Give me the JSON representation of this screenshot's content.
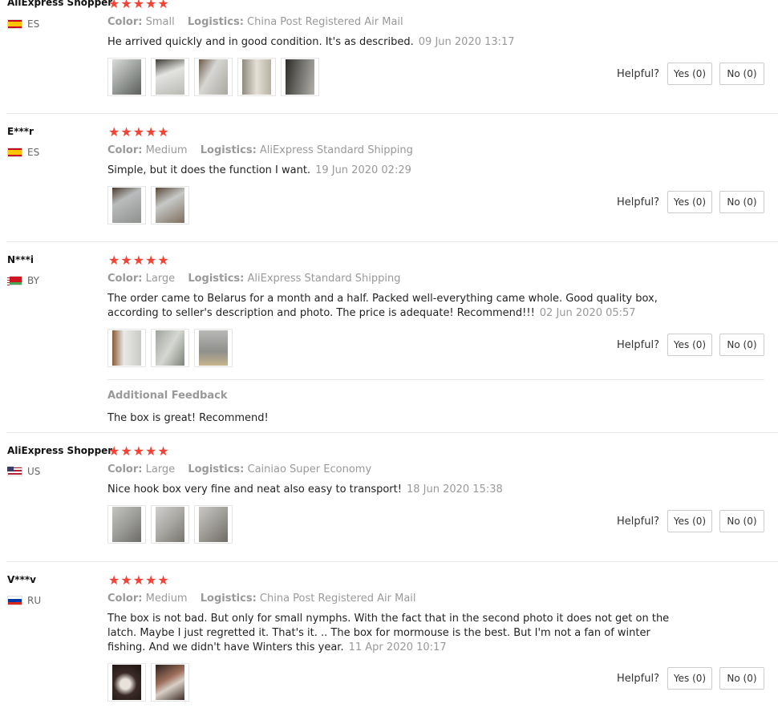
{
  "labels": {
    "color": "Color:",
    "logistics": "Logistics:",
    "helpful": "Helpful?",
    "yes": "Yes (0)",
    "no": "No (0)"
  },
  "reviews": [
    {
      "user": "AliExpress Shopper",
      "country": "ES",
      "color": "Small",
      "logistics": "China Post Registered Air Mail",
      "text": "He arrived quickly and in good condition. It's as described.",
      "date": "09 Jun 2020 13:17",
      "rating": 5,
      "photos": 5
    },
    {
      "user": "E***r",
      "country": "ES",
      "color": "Medium",
      "logistics": "AliExpress Standard Shipping",
      "text": "Simple, but it does the function I want.",
      "date": "19 Jun 2020 02:29",
      "rating": 5,
      "photos": 2
    },
    {
      "user": "N***i",
      "country": "BY",
      "color": "Large",
      "logistics": "AliExpress Standard Shipping",
      "text": "The order came to Belarus for a month and a half. Packed well-everything came whole. Good quality box, according to seller's description and photo. The price is adequate! Recommend!!!",
      "date": "02 Jun 2020 05:57",
      "rating": 5,
      "photos": 3,
      "additional_title": "Additional Feedback",
      "additional_text": "The box is great! Recommend!"
    },
    {
      "user": "AliExpress Shopper",
      "country": "US",
      "color": "Large",
      "logistics": "Cainiao Super Economy",
      "text": "Nice hook box very fine and neat also easy to transport!",
      "date": "18 Jun 2020 15:38",
      "rating": 5,
      "photos": 3
    },
    {
      "user": "V***v",
      "country": "RU",
      "color": "Medium",
      "logistics": "China Post Registered Air Mail",
      "text": "The box is not bad. But only for small nymphs. With the fact that in the second photo it does not get on the latch. Maybe I just regretted it. That's it. .. The box for mormouse is the best. But I'm not a fan of winter fishing. And we didn't have Winters this year.",
      "date": "11 Apr 2020 10:17",
      "rating": 5,
      "photos": 2
    }
  ]
}
